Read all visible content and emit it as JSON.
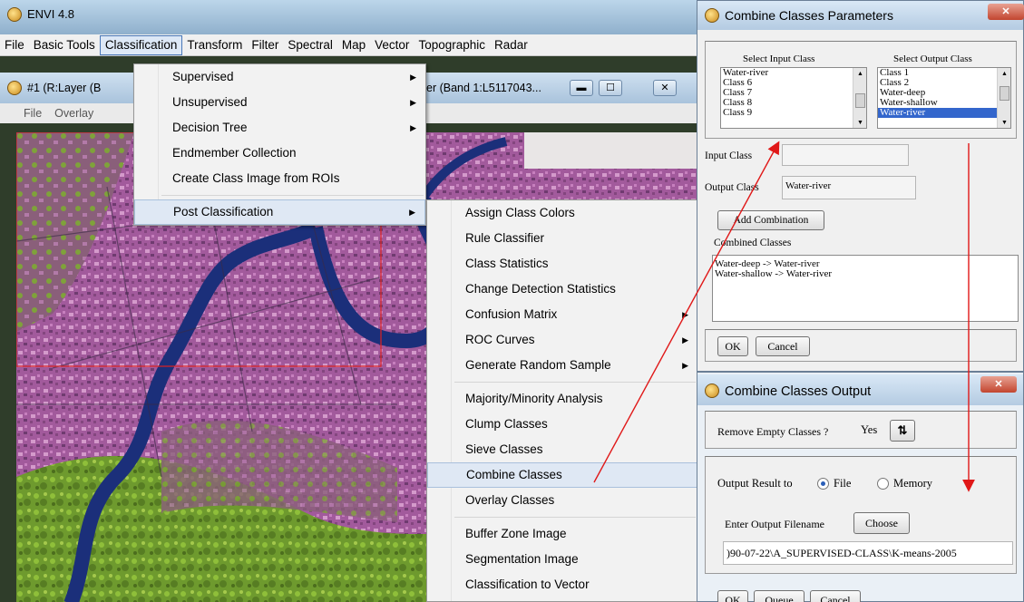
{
  "app": {
    "title": "ENVI 4.8"
  },
  "menubar": [
    "File",
    "Basic Tools",
    "Classification",
    "Transform",
    "Filter",
    "Spectral",
    "Map",
    "Vector",
    "Topographic",
    "Radar"
  ],
  "image_window": {
    "title_left": "#1 (R:Layer (B",
    "title_right": "er (Band 1:L5117043...",
    "menu": [
      "File",
      "Overlay"
    ]
  },
  "classification_menu": [
    {
      "label": "Supervised",
      "submenu": true
    },
    {
      "label": "Unsupervised",
      "submenu": true
    },
    {
      "label": "Decision Tree",
      "submenu": true
    },
    {
      "label": "Endmember Collection",
      "submenu": false
    },
    {
      "label": "Create Class Image from ROIs",
      "submenu": false
    },
    {
      "label": "Post Classification",
      "submenu": true,
      "highlighted": true
    }
  ],
  "post_classification_menu": [
    {
      "label": "Assign Class Colors",
      "submenu": false
    },
    {
      "label": "Rule Classifier",
      "submenu": false
    },
    {
      "label": "Class Statistics",
      "submenu": false
    },
    {
      "label": "Change Detection Statistics",
      "submenu": false
    },
    {
      "label": "Confusion Matrix",
      "submenu": true
    },
    {
      "label": "ROC Curves",
      "submenu": true
    },
    {
      "label": "Generate Random Sample",
      "submenu": true
    },
    {
      "label": "Majority/Minority Analysis",
      "submenu": false
    },
    {
      "label": "Clump Classes",
      "submenu": false
    },
    {
      "label": "Sieve Classes",
      "submenu": false
    },
    {
      "label": "Combine Classes",
      "submenu": false,
      "highlighted": true
    },
    {
      "label": "Overlay Classes",
      "submenu": false
    },
    {
      "label": "Buffer Zone Image",
      "submenu": false
    },
    {
      "label": "Segmentation Image",
      "submenu": false
    },
    {
      "label": "Classification to Vector",
      "submenu": false
    }
  ],
  "combine_params": {
    "title": "Combine Classes Parameters",
    "select_input_label": "Select Input Class",
    "select_output_label": "Select Output Class",
    "input_classes": [
      "Water-river",
      "Class 6",
      "Class 7",
      "Class 8",
      "Class 9"
    ],
    "output_classes": [
      "Class 1",
      "Class 2",
      "Water-deep",
      "Water-shallow",
      "Water-river"
    ],
    "output_selected": "Water-river",
    "input_class_label": "Input Class",
    "input_class_value": "",
    "output_class_label": "Output Class",
    "output_class_value": "Water-river",
    "add_combination": "Add Combination",
    "combined_label": "Combined Classes",
    "combined": [
      "Water-deep -> Water-river",
      "Water-shallow -> Water-river"
    ],
    "ok": "OK",
    "cancel": "Cancel"
  },
  "combine_output": {
    "title": "Combine Classes Output",
    "remove_empty_label": "Remove Empty Classes ?",
    "remove_empty_value": "Yes",
    "output_result_label": "Output Result to",
    "opt_file": "File",
    "opt_memory": "Memory",
    "selected_output": "File",
    "filename_label": "Enter Output Filename",
    "choose": "Choose",
    "filename": ")90-07-22\\A_SUPERVISED-CLASS\\K-means-2005",
    "ok": "OK",
    "queue": "Queue",
    "cancel": "Cancel"
  },
  "colors": {
    "annotation_arrow": "#e01818",
    "menu_highlight": "#dfe8f4",
    "list_selection": "#3366cc"
  }
}
